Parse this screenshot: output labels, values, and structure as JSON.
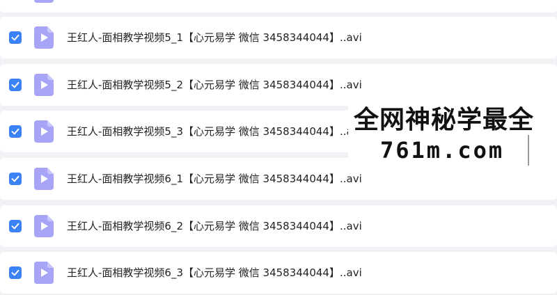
{
  "files": [
    {
      "name": "王红人-面相教学视频5_1【心元易学 微信 3458344044】..avi",
      "checked": true
    },
    {
      "name": "王红人-面相教学视频5_2【心元易学 微信 3458344044】..avi",
      "checked": true
    },
    {
      "name": "王红人-面相教学视频5_3【心元易学 微信 3458344044】..avi",
      "checked": true
    },
    {
      "name": "王红人-面相教学视频6_1【心元易学 微信 3458344044】..avi",
      "checked": true
    },
    {
      "name": "王红人-面相教学视频6_2【心元易学 微信 3458344044】..avi",
      "checked": true
    },
    {
      "name": "王红人-面相教学视频6_3【心元易学 微信 3458344044】..avi",
      "checked": true
    }
  ],
  "watermark": {
    "line1": "全网神秘学最全",
    "line2": "761m.com"
  },
  "colors": {
    "checkbox": "#3b82f6",
    "file_icon": "#a8a4f8",
    "background": "#f1f2f6"
  },
  "icons": {
    "checkbox": "checkmark-icon",
    "file": "video-file-icon"
  }
}
